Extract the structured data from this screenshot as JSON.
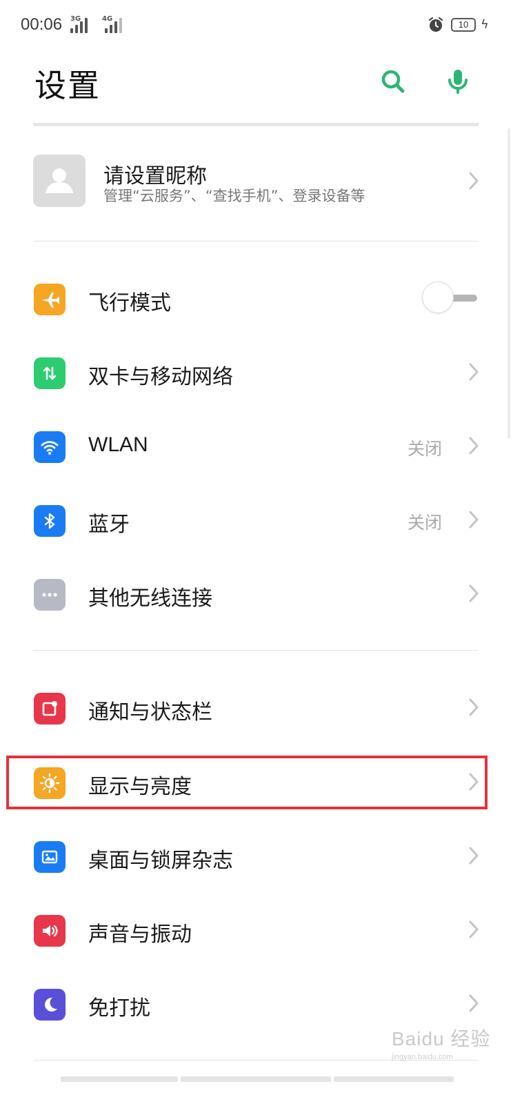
{
  "status_bar": {
    "time": "00:06",
    "net1": "3G",
    "net2": "4G",
    "battery": "10"
  },
  "header": {
    "title": "设置"
  },
  "profile": {
    "name": "请设置昵称",
    "subtitle": "管理“云服务”、“查找手机”、登录设备等"
  },
  "groups": {
    "connectivity": [
      {
        "label": "飞行模式",
        "icon": "airplane-icon",
        "color": "#f5a623",
        "toggle": false
      },
      {
        "label": "双卡与移动网络",
        "icon": "sim-swap-icon",
        "color": "#2ecc71"
      },
      {
        "label": "WLAN",
        "icon": "wifi-icon",
        "color": "#1a7cf5",
        "value": "关闭"
      },
      {
        "label": "蓝牙",
        "icon": "bluetooth-icon",
        "color": "#1a7cf5",
        "value": "关闭"
      },
      {
        "label": "其他无线连接",
        "icon": "more-dots-icon",
        "color": "#b7bac4"
      }
    ],
    "personalization": [
      {
        "label": "通知与状态栏",
        "icon": "notification-icon",
        "color": "#e8364a"
      },
      {
        "label": "显示与亮度",
        "icon": "brightness-icon",
        "color": "#f5a623",
        "highlighted": true
      },
      {
        "label": "桌面与锁屏杂志",
        "icon": "wallpaper-icon",
        "color": "#1a7cf5"
      },
      {
        "label": "声音与振动",
        "icon": "speaker-icon",
        "color": "#e8364a"
      },
      {
        "label": "免打扰",
        "icon": "moon-icon",
        "color": "#5a4fd8"
      }
    ]
  },
  "colors": {
    "accent": "#2bb673",
    "highlight_border": "#e2323c"
  },
  "watermark": {
    "brand": "Baidu 经验",
    "url": "jingyan.baidu.com"
  }
}
